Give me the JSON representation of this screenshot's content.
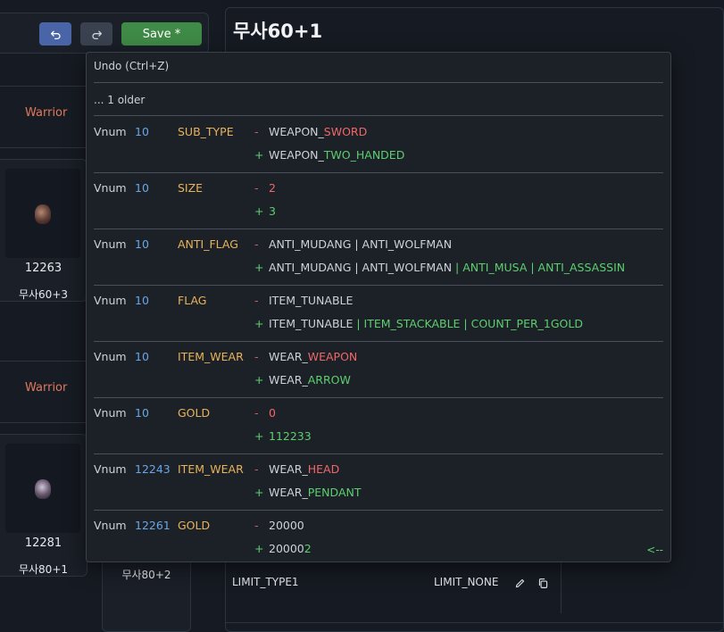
{
  "toolbar": {
    "undo_icon": "undo-icon",
    "redo_icon": "redo-icon",
    "save_label": "Save *"
  },
  "left": {
    "class_label_1": "Warrior",
    "class_label_2": "Warrior",
    "cards": [
      {
        "vnum": "12263",
        "name": "무사60+3"
      },
      {
        "vnum": "12281",
        "name": "무사80+1"
      }
    ],
    "card2_name": "무사80+2"
  },
  "detail": {
    "title": "무사60+1",
    "fields": [
      {
        "key": "LIMIT_TYPE1",
        "value": "LIMIT_NONE"
      }
    ]
  },
  "popup": {
    "title": "Undo (Ctrl+Z)",
    "older_note": "... 1 older",
    "entries": [
      {
        "label": "Vnum",
        "vnum": "10",
        "field": "SUB_TYPE",
        "minus": "-",
        "plus": "+",
        "old_a": "WEAPON_",
        "old_b": "SWORD",
        "new_a": "WEAPON_",
        "new_b": "TWO_HANDED"
      },
      {
        "label": "Vnum",
        "vnum": "10",
        "field": "SIZE",
        "minus": "-",
        "plus": "+",
        "old_a": "",
        "old_b": "2",
        "new_a": "",
        "new_b": "3"
      },
      {
        "label": "Vnum",
        "vnum": "10",
        "field": "ANTI_FLAG",
        "minus": "-",
        "plus": "+",
        "old_a": "ANTI_MUDANG | ANTI_WOLFMAN",
        "new_a": "ANTI_MUDANG | ANTI_WOLFMAN ",
        "new_sep1": "|",
        "new_b": " ANTI_MUSA ",
        "new_sep2": "|",
        "new_c": " ANTI_ASSASSIN"
      },
      {
        "label": "Vnum",
        "vnum": "10",
        "field": "FLAG",
        "minus": "-",
        "plus": "+",
        "old_a": "ITEM_TUNABLE",
        "new_a": "ITEM_TUNABLE ",
        "new_sep1": "|",
        "new_b": " ITEM_STACKABLE ",
        "new_sep2": "|",
        "new_c": " COUNT_PER_1GOLD"
      },
      {
        "label": "Vnum",
        "vnum": "10",
        "field": "ITEM_WEAR",
        "minus": "-",
        "plus": "+",
        "old_a": "WEAR_",
        "old_b": "WEAPON",
        "new_a": "WEAR_",
        "new_b": "ARROW"
      },
      {
        "label": "Vnum",
        "vnum": "10",
        "field": "GOLD",
        "minus": "-",
        "plus": "+",
        "old_a": "",
        "old_b": "0",
        "new_a": "",
        "new_b": "112233"
      },
      {
        "label": "Vnum",
        "vnum": "12243",
        "field": "ITEM_WEAR",
        "minus": "-",
        "plus": "+",
        "old_a": "WEAR_",
        "old_b": "HEAD",
        "new_a": "WEAR_",
        "new_b": "PENDANT"
      },
      {
        "label": "Vnum",
        "vnum": "12261",
        "field": "GOLD",
        "minus": "-",
        "plus": "+",
        "old_a": "20000",
        "old_b": "",
        "new_a": "20000",
        "new_b": "2"
      }
    ],
    "more_arrow": "<--"
  },
  "icons": {
    "edit": "pencil-icon",
    "copy": "copy-icon"
  },
  "colors": {
    "accent_blue": "#4a64a8",
    "save_green": "#3f8a47",
    "added": "#5ccf6e",
    "removed": "#e05a5a",
    "field": "#e8b35a",
    "vnum": "#6aa6e6"
  }
}
